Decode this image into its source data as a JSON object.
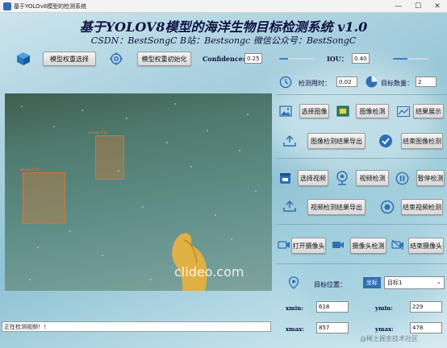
{
  "window": {
    "title": "基于YOLOv8模型的检测系统",
    "controls": [
      "—",
      "☐",
      "✕"
    ]
  },
  "header": {
    "title": "基于YOLOV8模型的海洋生物目标检测系统 v1.0",
    "subtitle": "CSDN：BestSongC   B站：Bestsongc   微信公众号：BestSongC"
  },
  "model": {
    "select_label": "模型权重选择",
    "init_label": "模型权重初始化",
    "confidence_label": "Confidence:",
    "confidence_value": "0.25",
    "iou_label": "IOU：",
    "iou_value": "0.40",
    "confidence_fraction": 0.25,
    "iou_fraction": 0.4
  },
  "stats": {
    "time_label": "检测用时：",
    "time_value": "0.02",
    "count_label": "目标数量：",
    "count_value": "2"
  },
  "image_ops": {
    "select": "选择图像",
    "detect": "图像检测",
    "show": "结果展示",
    "export": "图像检测结果导出",
    "finish": "结束图像检测"
  },
  "video_ops": {
    "select": "选择视频",
    "detect": "视频检测",
    "pause": "暂停检测",
    "export": "视频检测结果导出",
    "finish": "结束视频检测"
  },
  "camera_ops": {
    "open": "打开摄像头",
    "detect": "摄像头检测",
    "close": "结束摄像头"
  },
  "target": {
    "pos_label": "目标位置：",
    "pos_badge": "坐标",
    "combo_value": "目标1",
    "xmin_label": "xmin:",
    "xmin_value": "618",
    "ymin_label": "ymin:",
    "ymin_value": "229",
    "xmax_label": "xmax:",
    "xmax_value": "857",
    "ymax_label": "ymax:",
    "ymax_value": "478"
  },
  "video": {
    "detections": [
      {
        "label": "person 0.55"
      },
      {
        "label": "person 0.62"
      }
    ],
    "watermark": "clideo.com"
  },
  "status_text": "正在检测视频！！",
  "footer_watermark": "@稀土掘金技术社区",
  "colors": {
    "accent": "#3a7bd5",
    "box": "#e0702c",
    "title": "#0d1140"
  }
}
